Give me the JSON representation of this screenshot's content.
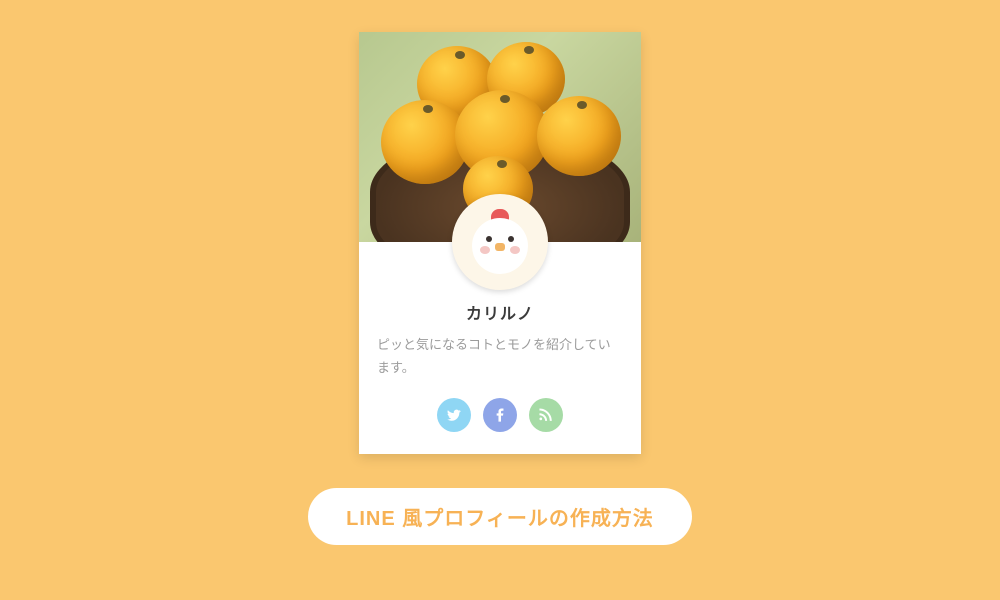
{
  "profile": {
    "name": "カリルノ",
    "bio": "ピッと気になるコトとモノを紹介しています。"
  },
  "social": {
    "twitter": "twitter",
    "facebook": "facebook",
    "rss": "rss"
  },
  "cta": {
    "label": "LINE 風プロフィールの作成方法"
  }
}
